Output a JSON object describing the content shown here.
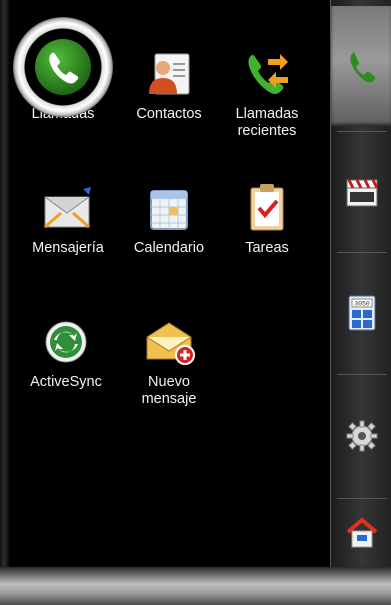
{
  "apps": [
    {
      "key": "llamadas",
      "label": "Llamadas",
      "icon": "phone-icon",
      "selected": true
    },
    {
      "key": "contactos",
      "label": "Contactos",
      "icon": "contacts-icon"
    },
    {
      "key": "llamadas_recientes",
      "label": "Llamadas\nrecientes",
      "icon": "recent-calls-icon"
    },
    {
      "key": "mensajeria",
      "label": "Mensajería",
      "icon": "envelope-icon"
    },
    {
      "key": "calendario",
      "label": "Calendario",
      "icon": "calendar-icon"
    },
    {
      "key": "tareas",
      "label": "Tareas",
      "icon": "clipboard-check-icon"
    },
    {
      "key": "activesync",
      "label": "ActiveSync",
      "icon": "sync-icon"
    },
    {
      "key": "nuevo_mensaje",
      "label": "Nuevo\nmensaje",
      "icon": "new-message-icon"
    }
  ],
  "sidebar": [
    {
      "icon": "phone-icon",
      "active": true
    },
    {
      "icon": "clapperboard-icon"
    },
    {
      "icon": "calculator-icon",
      "calc_display": "3050"
    },
    {
      "icon": "gear-icon"
    },
    {
      "icon": "home-icon"
    }
  ],
  "colors": {
    "phone_green": "#3a9a2a",
    "sync_green": "#2f8f3a",
    "arrow_orange": "#f0a020",
    "badge_red": "#d42020"
  }
}
